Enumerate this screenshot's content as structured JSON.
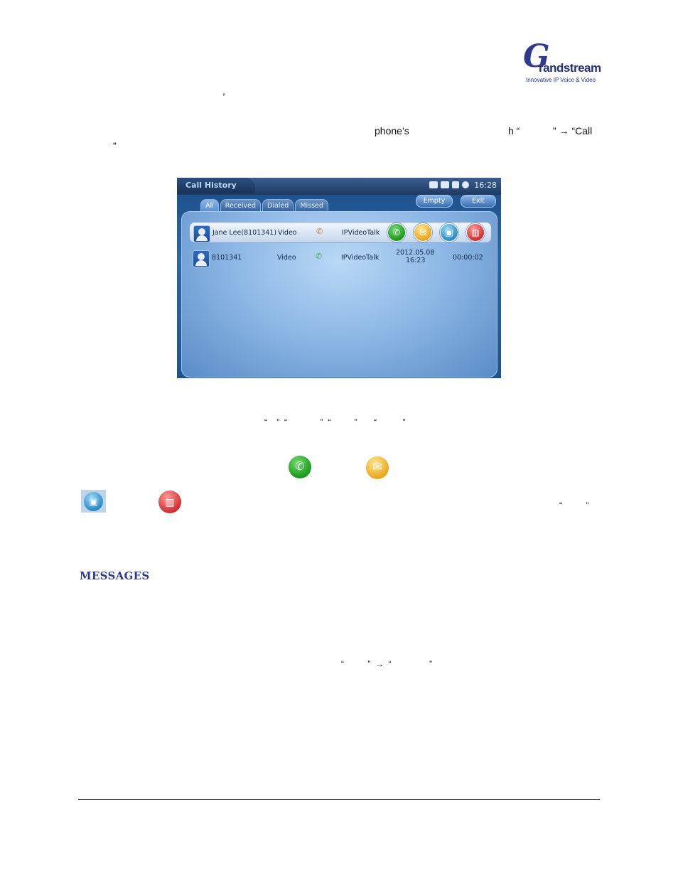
{
  "logo": {
    "mark": "G",
    "name": "randstream",
    "tagline": "Innovative IP Voice & Video"
  },
  "fragments": {
    "comma": ",",
    "phones": "phone’s",
    "h_quote": "h “",
    "close_arrow_call": "” → “Call",
    "close_quote_1": "”",
    "tabs_line": "“    ”  “              ”  “          ”       “           ”",
    "quote_right_pair": "“          ”",
    "arrow_line": "“          ”  →  “                ”"
  },
  "screenshot": {
    "title": "Call History",
    "clock": "16:28",
    "tabs": [
      "All",
      "Received",
      "Dialed",
      "Missed"
    ],
    "buttons": {
      "empty": "Empty",
      "exit": "Exit"
    },
    "rows": [
      {
        "name": "Jane Lee(8101341)",
        "type": "Video",
        "account": "IPVideoTalk",
        "date": "",
        "time": "",
        "duration": ""
      },
      {
        "name": "8101341",
        "type": "Video",
        "account": "IPVideoTalk",
        "date": "2012.05.08",
        "time": "16:23",
        "duration": "00:00:02"
      }
    ]
  },
  "section": {
    "heading": "MESSAGES"
  },
  "icons": [
    "phone-icon",
    "message-icon",
    "contact-icon",
    "trash-icon"
  ],
  "colors": {
    "heading": "#2e3a8c",
    "brand": "#2f3a8f"
  }
}
